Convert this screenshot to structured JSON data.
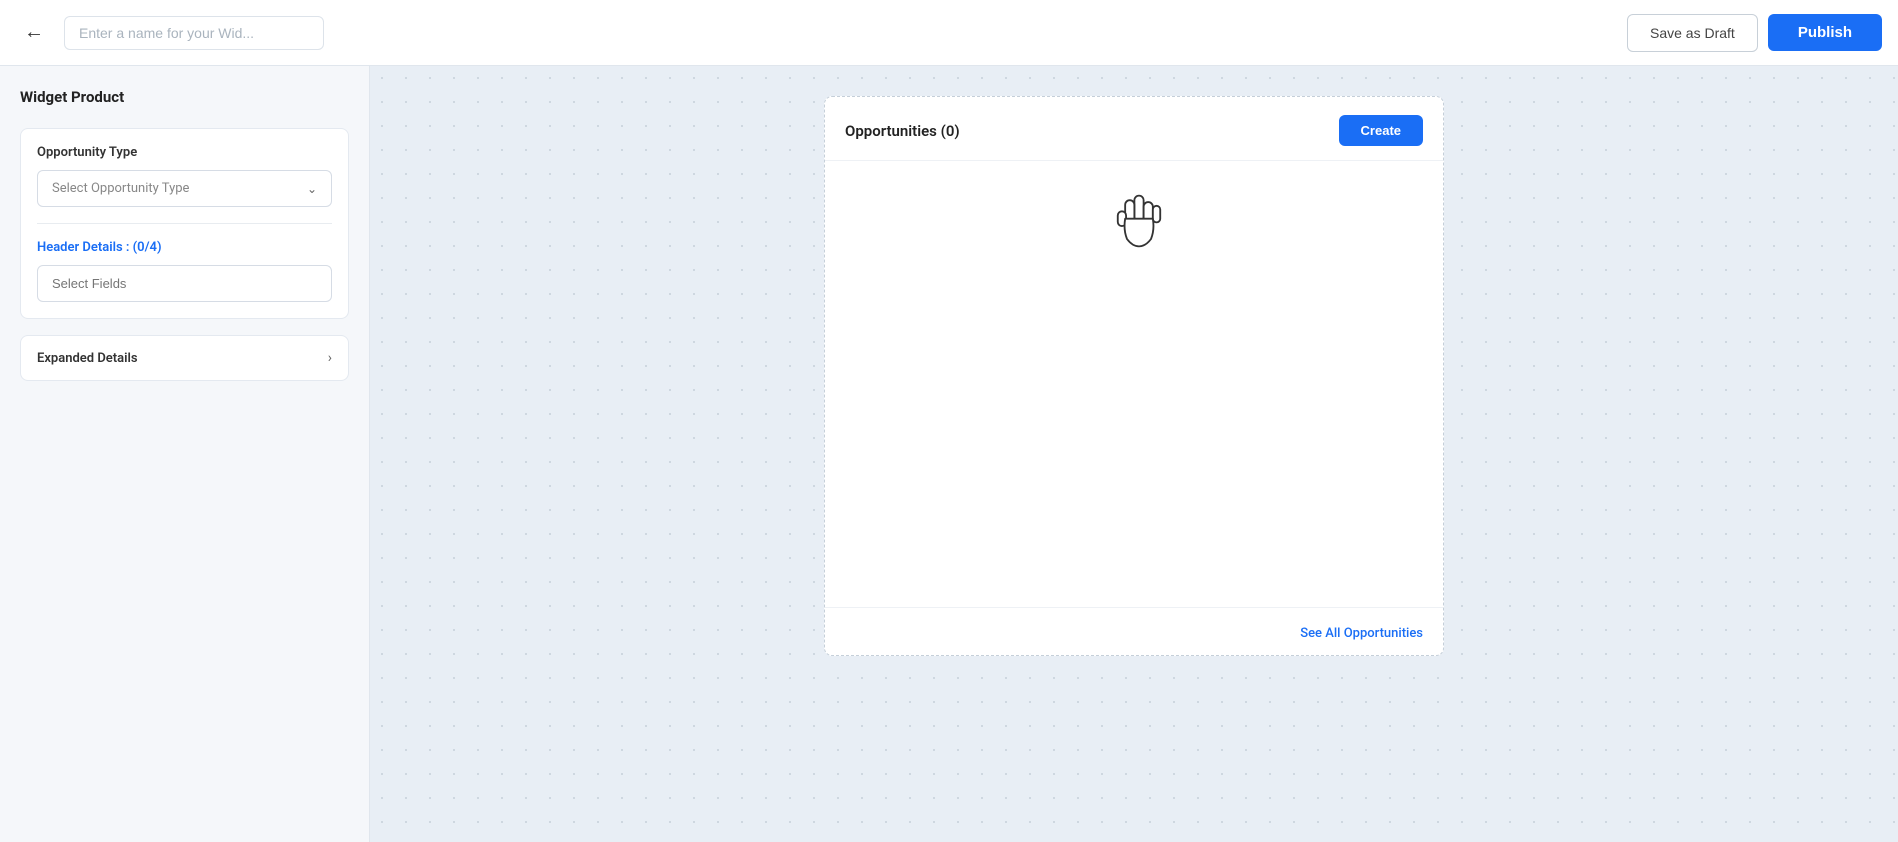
{
  "topbar": {
    "name_input_placeholder": "Enter a name for your Wid...",
    "save_draft_label": "Save as Draft",
    "publish_label": "Publish"
  },
  "sidebar": {
    "title": "Widget Product",
    "opportunity_type_label": "Opportunity Type",
    "opportunity_type_placeholder": "Select Opportunity Type",
    "header_details_label": "Header Details : (0/4)",
    "select_fields_placeholder": "Select Fields",
    "expanded_details_label": "Expanded Details"
  },
  "widget": {
    "title": "Opportunities (0)",
    "create_label": "Create",
    "see_all_label": "See All Opportunities"
  },
  "colors": {
    "primary": "#1a6ef5",
    "text_dark": "#222222",
    "text_muted": "#888888",
    "border": "#e4e9f0"
  }
}
